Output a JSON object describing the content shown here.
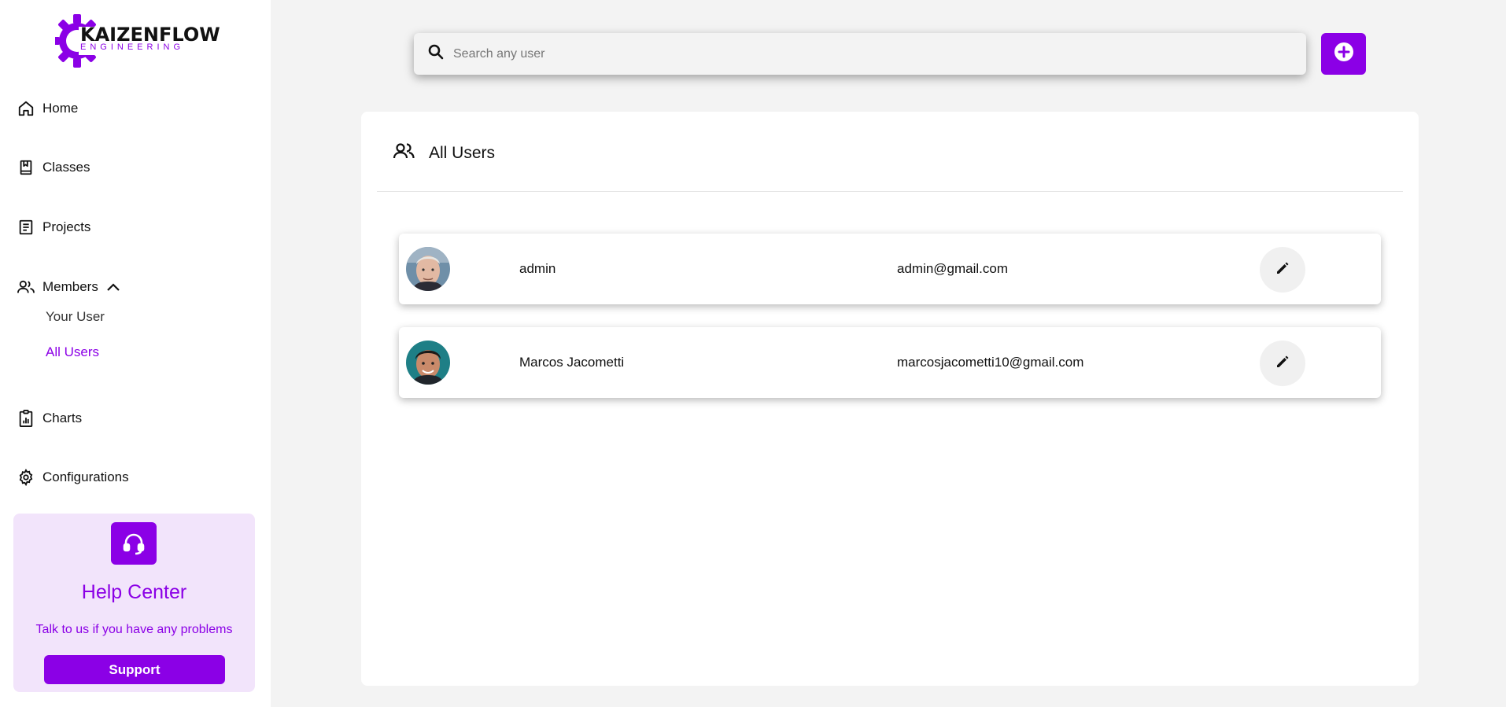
{
  "brand": {
    "name": "KAIZENFLOW",
    "tagline": "ENGINEERING",
    "accent_color": "#8b00e6"
  },
  "sidebar": {
    "items": [
      {
        "label": "Home",
        "icon": "home-icon"
      },
      {
        "label": "Classes",
        "icon": "book-icon"
      },
      {
        "label": "Projects",
        "icon": "document-icon"
      },
      {
        "label": "Members",
        "icon": "users-icon",
        "expanded": true
      },
      {
        "label": "Charts",
        "icon": "clipboard-chart-icon"
      },
      {
        "label": "Configurations",
        "icon": "gear-icon"
      }
    ],
    "members_sub": [
      {
        "label": "Your User",
        "active": false
      },
      {
        "label": "All Users",
        "active": true
      }
    ]
  },
  "help": {
    "title": "Help Center",
    "text": "Talk to us if you have any problems",
    "button_label": "Support",
    "icon": "headset-icon"
  },
  "search": {
    "placeholder": "Search any user",
    "value": ""
  },
  "add_button": {
    "icon": "plus-circle-icon"
  },
  "panel": {
    "title": "All Users",
    "icon": "users-icon"
  },
  "users": [
    {
      "name": "admin",
      "email": "admin@gmail.com"
    },
    {
      "name": "Marcos Jacometti",
      "email": "marcosjacometti10@gmail.com"
    }
  ]
}
